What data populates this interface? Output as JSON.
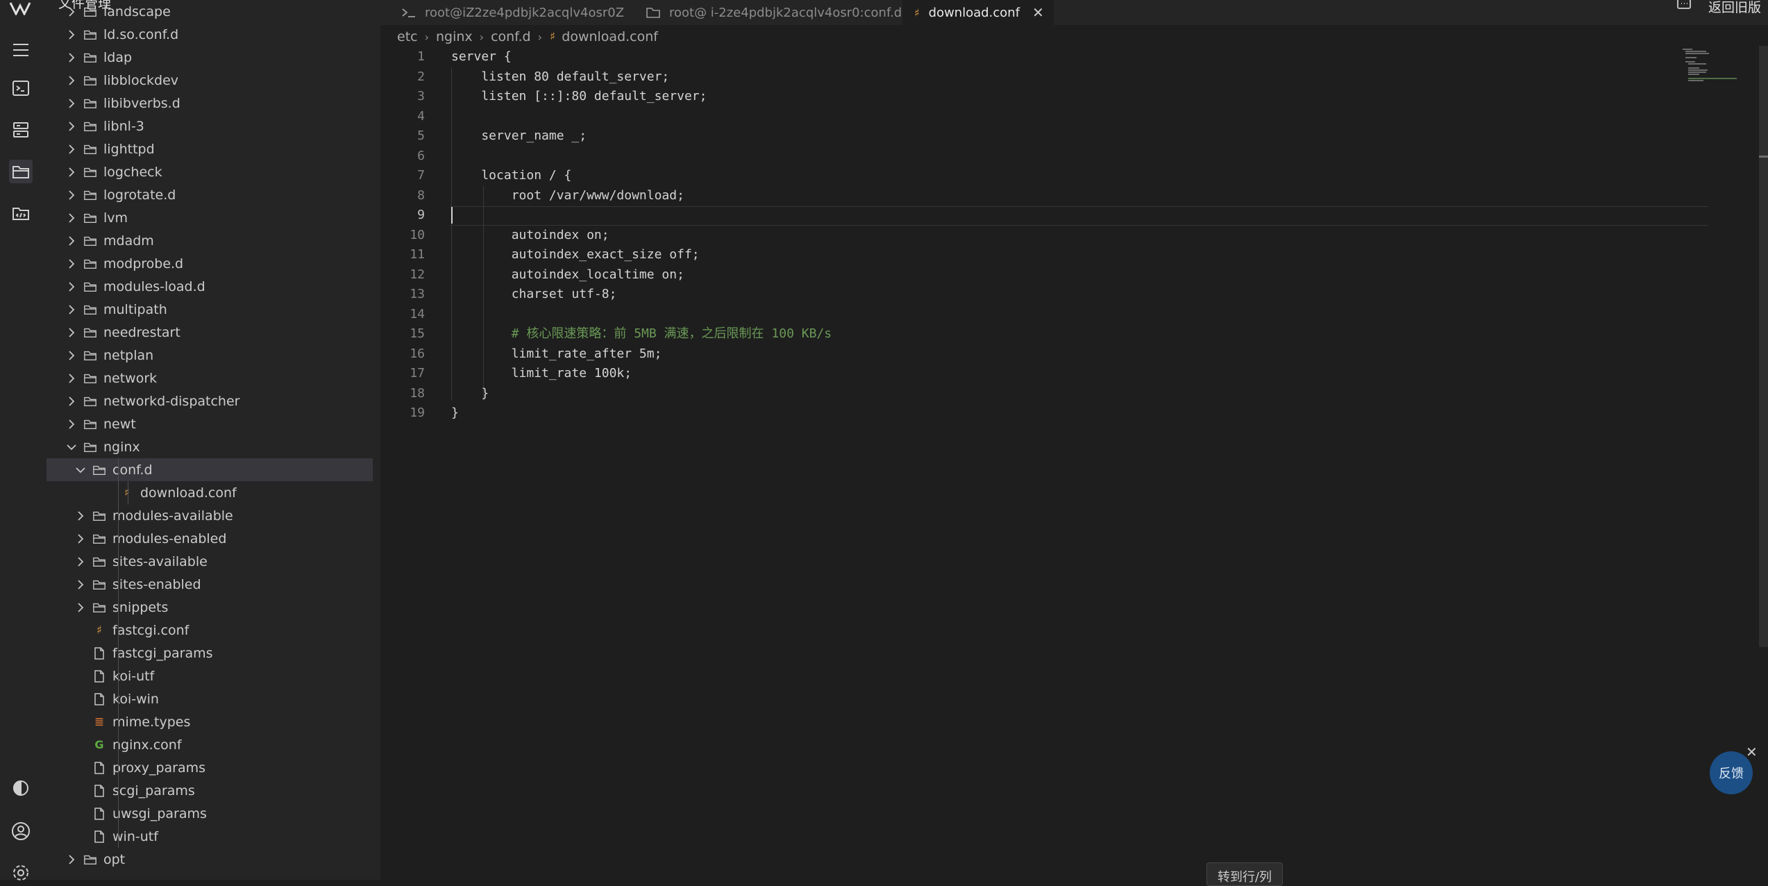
{
  "sidebar": {
    "title": "文件管理",
    "items": [
      {
        "label": "landscape",
        "type": "folder",
        "level": 0,
        "expanded": false
      },
      {
        "label": "ld.so.conf.d",
        "type": "folder",
        "level": 0,
        "expanded": false
      },
      {
        "label": "ldap",
        "type": "folder",
        "level": 0,
        "expanded": false
      },
      {
        "label": "libblockdev",
        "type": "folder",
        "level": 0,
        "expanded": false
      },
      {
        "label": "libibverbs.d",
        "type": "folder",
        "level": 0,
        "expanded": false
      },
      {
        "label": "libnl-3",
        "type": "folder",
        "level": 0,
        "expanded": false
      },
      {
        "label": "lighttpd",
        "type": "folder",
        "level": 0,
        "expanded": false
      },
      {
        "label": "logcheck",
        "type": "folder",
        "level": 0,
        "expanded": false
      },
      {
        "label": "logrotate.d",
        "type": "folder",
        "level": 0,
        "expanded": false
      },
      {
        "label": "lvm",
        "type": "folder",
        "level": 0,
        "expanded": false
      },
      {
        "label": "mdadm",
        "type": "folder",
        "level": 0,
        "expanded": false
      },
      {
        "label": "modprobe.d",
        "type": "folder",
        "level": 0,
        "expanded": false
      },
      {
        "label": "modules-load.d",
        "type": "folder",
        "level": 0,
        "expanded": false
      },
      {
        "label": "multipath",
        "type": "folder",
        "level": 0,
        "expanded": false
      },
      {
        "label": "needrestart",
        "type": "folder",
        "level": 0,
        "expanded": false
      },
      {
        "label": "netplan",
        "type": "folder",
        "level": 0,
        "expanded": false
      },
      {
        "label": "network",
        "type": "folder",
        "level": 0,
        "expanded": false
      },
      {
        "label": "networkd-dispatcher",
        "type": "folder",
        "level": 0,
        "expanded": false
      },
      {
        "label": "newt",
        "type": "folder",
        "level": 0,
        "expanded": false
      },
      {
        "label": "nginx",
        "type": "folder",
        "level": 0,
        "expanded": true
      },
      {
        "label": "conf.d",
        "type": "folder",
        "level": 1,
        "expanded": true,
        "selected": true
      },
      {
        "label": "download.conf",
        "type": "conf",
        "level": 2
      },
      {
        "label": "modules-available",
        "type": "folder",
        "level": 1,
        "expanded": false
      },
      {
        "label": "modules-enabled",
        "type": "folder",
        "level": 1,
        "expanded": false
      },
      {
        "label": "sites-available",
        "type": "folder",
        "level": 1,
        "expanded": false
      },
      {
        "label": "sites-enabled",
        "type": "folder",
        "level": 1,
        "expanded": false
      },
      {
        "label": "snippets",
        "type": "folder",
        "level": 1,
        "expanded": false
      },
      {
        "label": "fastcgi.conf",
        "type": "conf",
        "level": 1
      },
      {
        "label": "fastcgi_params",
        "type": "file",
        "level": 1
      },
      {
        "label": "koi-utf",
        "type": "file",
        "level": 1
      },
      {
        "label": "koi-win",
        "type": "file",
        "level": 1
      },
      {
        "label": "mime.types",
        "type": "mime",
        "level": 1
      },
      {
        "label": "nginx.conf",
        "type": "nginx",
        "level": 1
      },
      {
        "label": "proxy_params",
        "type": "file",
        "level": 1
      },
      {
        "label": "scgi_params",
        "type": "file",
        "level": 1
      },
      {
        "label": "uwsgi_params",
        "type": "file",
        "level": 1
      },
      {
        "label": "win-utf",
        "type": "file",
        "level": 1
      },
      {
        "label": "opt",
        "type": "folder",
        "level": 0,
        "expanded": false
      }
    ]
  },
  "tabs": [
    {
      "label": "root@iZ2ze4pdbjk2acqlv4osr0Z",
      "icon": "terminal-icon",
      "active": false
    },
    {
      "label": "root@ i-2ze4pdbjk2acqlv4osr0:conf.d",
      "icon": "folder-icon",
      "active": false
    },
    {
      "label": "download.conf",
      "icon": "conf-file-icon",
      "active": true
    }
  ],
  "topbar": {
    "return_old": "返回旧版"
  },
  "breadcrumb": [
    "etc",
    "nginx",
    "conf.d",
    "download.conf"
  ],
  "editor": {
    "current_line": 9,
    "lines": [
      {
        "n": "1",
        "text": "server {"
      },
      {
        "n": "2",
        "text": "    listen 80 default_server;"
      },
      {
        "n": "3",
        "text": "    listen [::]:80 default_server;"
      },
      {
        "n": "4",
        "text": ""
      },
      {
        "n": "5",
        "text": "    server_name _;"
      },
      {
        "n": "6",
        "text": ""
      },
      {
        "n": "7",
        "text": "    location / {"
      },
      {
        "n": "8",
        "text": "        root /var/www/download;"
      },
      {
        "n": "9",
        "text": ""
      },
      {
        "n": "10",
        "text": "        autoindex on;"
      },
      {
        "n": "11",
        "text": "        autoindex_exact_size off;"
      },
      {
        "n": "12",
        "text": "        autoindex_localtime on;"
      },
      {
        "n": "13",
        "text": "        charset utf-8;"
      },
      {
        "n": "14",
        "text": ""
      },
      {
        "n": "15",
        "text": "        # 核心限速策略：前 5MB 满速，之后限制在 100 KB/s",
        "comment": true
      },
      {
        "n": "16",
        "text": "        limit_rate_after 5m;"
      },
      {
        "n": "17",
        "text": "        limit_rate 100k;"
      },
      {
        "n": "18",
        "text": "    }"
      },
      {
        "n": "19",
        "text": "}"
      }
    ]
  },
  "feedback": {
    "label": "反馈"
  },
  "tooltip": {
    "label": "转到行/列"
  },
  "colors": {
    "background": "#1e1e1e",
    "sidebar": "#252526",
    "comment": "#6a9955",
    "conf_icon": "#e8a046",
    "feedback": "#1b4f86"
  }
}
